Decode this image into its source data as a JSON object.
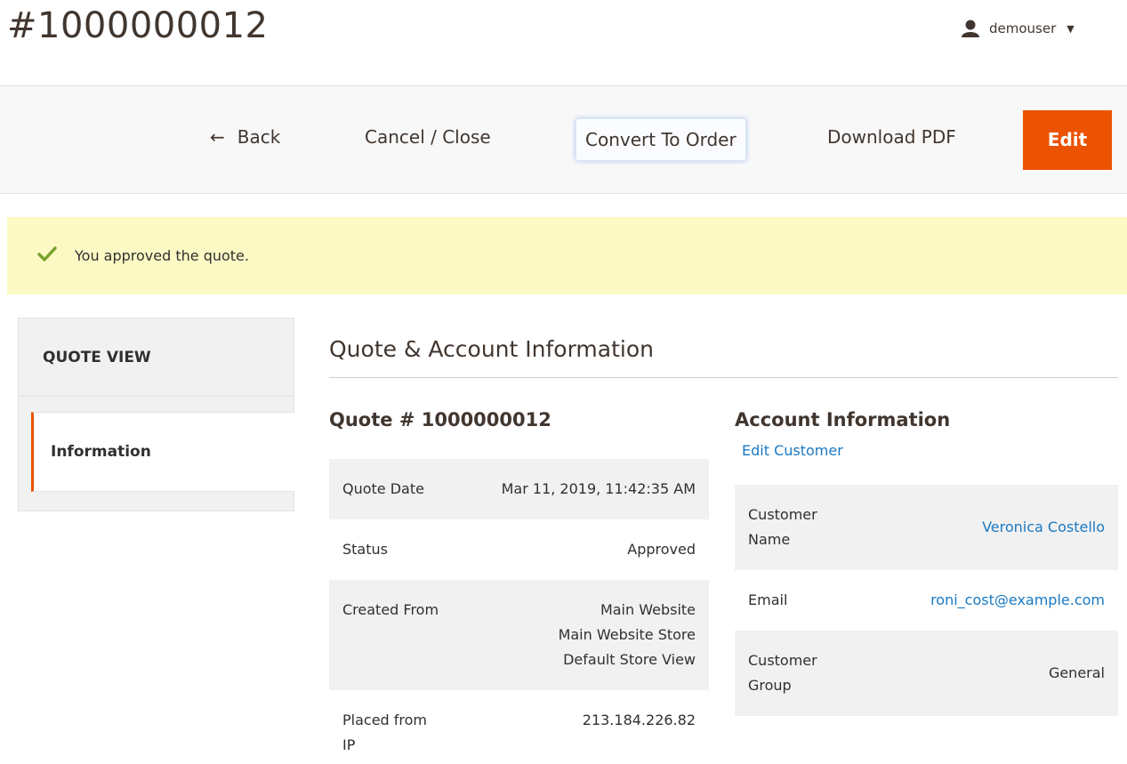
{
  "page": {
    "title": "#1000000012",
    "user": {
      "name": "demouser",
      "icon": "user-icon",
      "caret_icon": "caret-down-icon"
    }
  },
  "actions": {
    "back_label": "Back",
    "cancel_label": "Cancel / Close",
    "convert_label": "Convert To Order",
    "download_label": "Download PDF",
    "edit_label": "Edit"
  },
  "message": {
    "text": "You approved the quote.",
    "icon": "checkmark-icon"
  },
  "sidebar": {
    "title": "QUOTE VIEW",
    "items": [
      {
        "label": "Information",
        "active": true
      }
    ]
  },
  "main": {
    "section_title": "Quote & Account Information",
    "quote": {
      "title": "Quote # 1000000012",
      "rows": [
        {
          "label": "Quote Date",
          "value": "Mar 11, 2019, 11:42:35 AM"
        },
        {
          "label": "Status",
          "value": "Approved"
        },
        {
          "label": "Created From",
          "value_lines": [
            "Main Website",
            "Main Website Store",
            "Default Store View"
          ]
        },
        {
          "label": "Placed from IP",
          "value": "213.184.226.82"
        }
      ]
    },
    "account": {
      "title": "Account Information",
      "edit_link": "Edit Customer",
      "rows": [
        {
          "label": "Customer Name",
          "value": "Veronica Costello"
        },
        {
          "label": "Email",
          "value": "roni_cost@example.com"
        },
        {
          "label": "Customer Group",
          "value": "General"
        }
      ]
    }
  },
  "colors": {
    "accent": "#eb5202",
    "link": "#1979c3",
    "message_bg": "#fdf9c4",
    "success": "#79a22e"
  }
}
